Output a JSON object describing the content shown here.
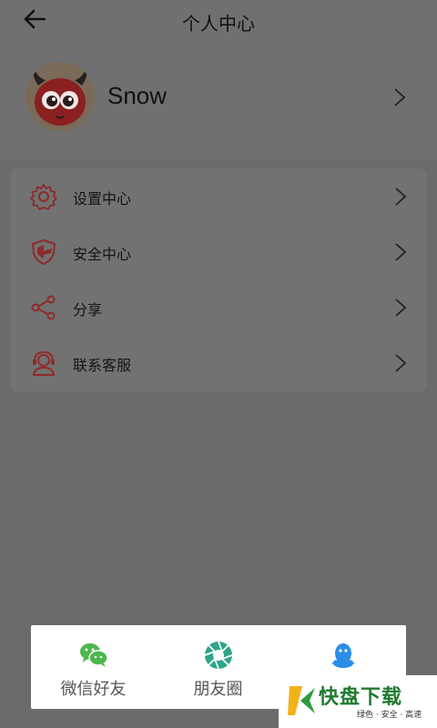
{
  "header": {
    "title": "个人中心",
    "back_icon": "arrow-left-icon"
  },
  "profile": {
    "username": "Snow",
    "avatar_icon": "devil-avatar"
  },
  "menu": {
    "items": [
      {
        "label": "设置中心",
        "icon": "gear-icon"
      },
      {
        "label": "安全中心",
        "icon": "shield-icon"
      },
      {
        "label": "分享",
        "icon": "share-icon"
      },
      {
        "label": "联系客服",
        "icon": "customer-service-icon"
      }
    ]
  },
  "share_sheet": {
    "options": [
      {
        "label": "微信好友",
        "icon": "wechat-icon",
        "color": "#4cb84c"
      },
      {
        "label": "朋友圈",
        "icon": "moments-icon",
        "color": "#2ea58a"
      },
      {
        "label": "QQ",
        "icon": "qq-icon",
        "color": "#2b8de8"
      }
    ]
  },
  "watermark": {
    "text": "快盘下载",
    "sub": "绿色 · 安全 · 高速"
  },
  "colors": {
    "accent_red": "#8e2a2a",
    "overlay": "#6b6b6b"
  }
}
